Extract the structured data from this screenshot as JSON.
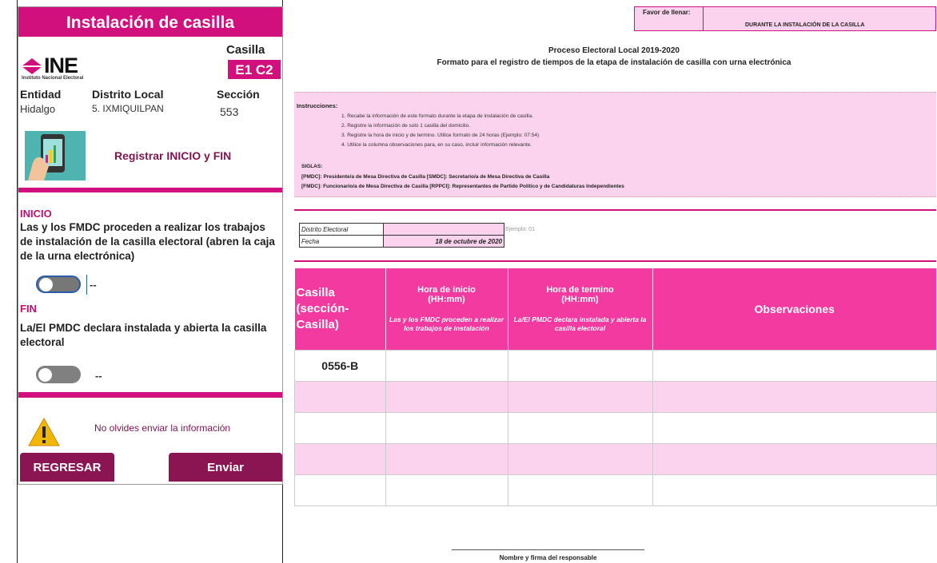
{
  "phone": {
    "title": "Instalación de casilla",
    "logo_text": "INE",
    "logo_sub": "Instituto Nacional Electoral",
    "casilla_label": "Casilla",
    "casilla_code": "E1 C2",
    "entidad_label": "Entidad",
    "entidad_value": "Hidalgo",
    "distrito_label": "Distrito Local",
    "distrito_value": "5. IXMIQUILPAN",
    "seccion_label": "Sección",
    "seccion_value": "553",
    "register_link": "Registrar INICIO y FIN",
    "inicio_head": "INICIO",
    "inicio_text": "Las y los FMDC proceden a realizar los trabajos de instalación de la casilla electoral (abren la caja de la urna electrónica)",
    "inicio_time": "--",
    "fin_head": "FIN",
    "fin_text": "La/El PMDC declara instalada y abierta la casilla electoral",
    "fin_time": "--",
    "warning_text": "No olvides enviar la información",
    "back_button": "REGRESAR",
    "send_button": "Enviar"
  },
  "form": {
    "fill_label": "Favor de llenar:",
    "fill_value": "DURANTE LA INSTALACIÓN DE LA CASILLA",
    "title_line1": "Proceso Electoral Local 2019-2020",
    "title_line2": "Formato para el registro de tiempos de la etapa de instalación de casilla con urna electrónica",
    "instructions_head": "Instrucciones:",
    "instructions": [
      "1. Recabe la información de este formato durante la etapa de instalación de casilla.",
      "2. Registre la información de solo 1 casilla del domicilio.",
      "3. Registre la hora de inicio y de termino. Utilice formato de 24 horas (Ejemplo: 07:54)",
      "4. Utilice la columna observaciones para, en su caso, incluir información relevante."
    ],
    "siglas_head": "SIGLAS:",
    "siglas_line1": "[PMDC]: Presidente/a de Mesa Directiva de Casilla  [SMDC]: Secretario/a de Mesa Directiva de Casilla",
    "siglas_line2": "[FMDC]: Funcionario/a de Mesa Directiva de Casilla  [RPPCI]: Representantes de Partido Político y de Candidaturas Independientes",
    "distrito_label": "Distrito Electoral",
    "distrito_value": "",
    "distrito_example": "Ejemplo: 01",
    "fecha_label": "Fecha",
    "fecha_value": "18 de octubre de 2020",
    "col_casilla": "Casilla (sección-Casilla)",
    "col_inicio": "Hora de inicio (HH:mm)",
    "col_inicio_sub": "Las y los FMDC proceden a realizar los trabajos de instalación",
    "col_termino": "Hora de termino (HH:mm)",
    "col_termino_sub": "La/El PMDC declara instalada y abierta la casilla electoral",
    "col_obs": "Observaciones",
    "rows": [
      {
        "casilla": "0556-B",
        "inicio": "",
        "termino": "",
        "obs": ""
      },
      {
        "casilla": "",
        "inicio": "",
        "termino": "",
        "obs": ""
      },
      {
        "casilla": "",
        "inicio": "",
        "termino": "",
        "obs": ""
      },
      {
        "casilla": "",
        "inicio": "",
        "termino": "",
        "obs": ""
      },
      {
        "casilla": "",
        "inicio": "",
        "termino": "",
        "obs": ""
      }
    ],
    "signature_label": "Nombre y firma del responsable"
  },
  "colors": {
    "accent": "#d1107e",
    "header_pink": "#f23aa1",
    "light_pink": "#fbd3ee",
    "button": "#8b1552"
  }
}
